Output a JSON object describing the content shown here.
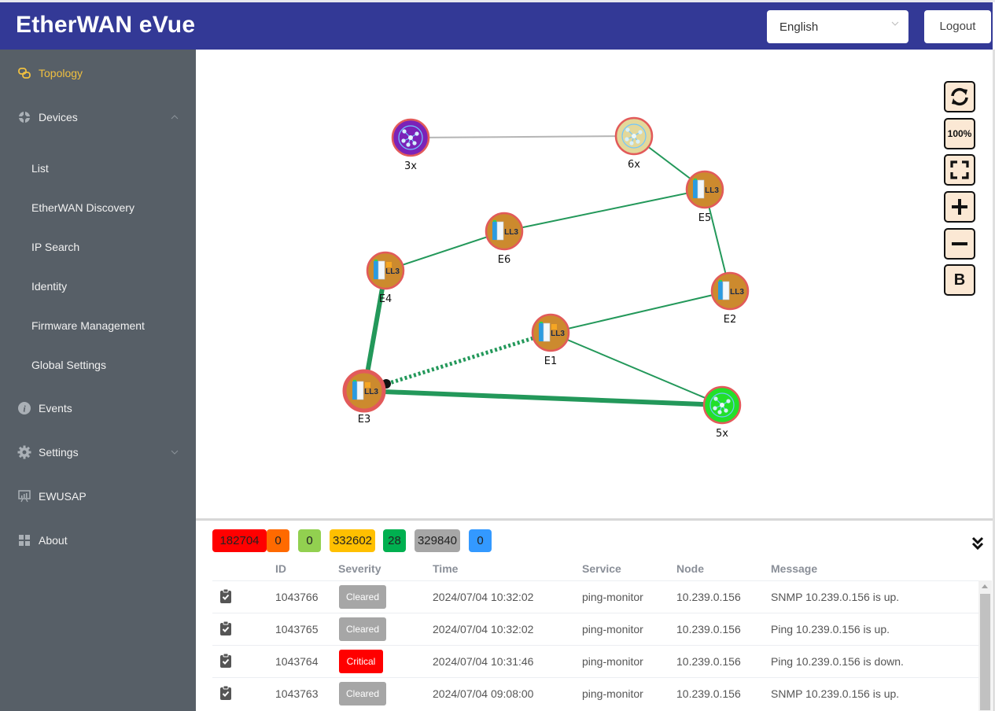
{
  "header": {
    "title": "EtherWAN eVue",
    "language": {
      "selected": "English"
    },
    "logout_label": "Logout"
  },
  "sidebar": {
    "items": [
      {
        "label": "Topology",
        "icon": "topology-icon",
        "active": true
      },
      {
        "label": "Devices",
        "icon": "devices-icon",
        "expanded": true
      },
      {
        "label": "List",
        "sub": true
      },
      {
        "label": "EtherWAN Discovery",
        "sub": true
      },
      {
        "label": "IP Search",
        "sub": true
      },
      {
        "label": "Identity",
        "sub": true
      },
      {
        "label": "Firmware Management",
        "sub": true
      },
      {
        "label": "Global Settings",
        "sub": true
      },
      {
        "label": "Events",
        "icon": "info-icon"
      },
      {
        "label": "Settings",
        "icon": "gear-icon",
        "expanded": false
      },
      {
        "label": "EWUSAP",
        "icon": "presentation-icon"
      },
      {
        "label": "About",
        "icon": "grid-icon"
      }
    ]
  },
  "topology": {
    "toolbar": {
      "refresh": "refresh-icon",
      "zoom_reset_label": "100%",
      "fit": "fullscreen-icon",
      "zoom_in": "plus-icon",
      "zoom_out": "minus-icon",
      "bold_label": "B"
    },
    "nodes": [
      {
        "id": "3x",
        "label": "3x",
        "type": "group",
        "color": "#7b22b8"
      },
      {
        "id": "6x",
        "label": "6x",
        "type": "group",
        "color": "#e3d89a"
      },
      {
        "id": "5x",
        "label": "5x",
        "type": "group",
        "color": "#22e02a"
      },
      {
        "id": "E1",
        "label": "E1",
        "type": "switch",
        "badge": "LL3",
        "alert": true
      },
      {
        "id": "E2",
        "label": "E2",
        "type": "switch",
        "badge": "LL3",
        "alert": false
      },
      {
        "id": "E3",
        "label": "E3",
        "type": "switch",
        "badge": "LL3",
        "alert": true,
        "selected": true
      },
      {
        "id": "E4",
        "label": "E4",
        "type": "switch",
        "badge": "LL3",
        "alert": true
      },
      {
        "id": "E5",
        "label": "E5",
        "type": "switch",
        "badge": "LL3",
        "alert": false
      },
      {
        "id": "E6",
        "label": "E6",
        "type": "switch",
        "badge": "LL3",
        "alert": false
      }
    ],
    "links": [
      {
        "from": "3x",
        "to": "6x",
        "style": "thin-gray"
      },
      {
        "from": "6x",
        "to": "E5",
        "style": "thin-green"
      },
      {
        "from": "E5",
        "to": "E6",
        "style": "thin-green"
      },
      {
        "from": "E5",
        "to": "E2",
        "style": "thin-green"
      },
      {
        "from": "E6",
        "to": "E4",
        "style": "thin-green"
      },
      {
        "from": "E4",
        "to": "E3",
        "style": "thick-green"
      },
      {
        "from": "E2",
        "to": "E1",
        "style": "thin-green"
      },
      {
        "from": "E1",
        "to": "5x",
        "style": "thin-green"
      },
      {
        "from": "E3",
        "to": "E1",
        "style": "dashed-green"
      },
      {
        "from": "E3",
        "to": "5x",
        "style": "thick-green"
      }
    ]
  },
  "events": {
    "counters": [
      {
        "value": "182704",
        "color": "#ff0000"
      },
      {
        "value": "0",
        "color": "#ff6a00"
      },
      {
        "value": "0",
        "color": "#92d050"
      },
      {
        "value": "332602",
        "color": "#ffc000"
      },
      {
        "value": "28",
        "color": "#00b050"
      },
      {
        "value": "329840",
        "color": "#a6a6a6"
      },
      {
        "value": "0",
        "color": "#3399ff"
      }
    ],
    "columns": [
      "ID",
      "Severity",
      "Time",
      "Service",
      "Node",
      "Message"
    ],
    "rows": [
      {
        "id": "1043766",
        "severity": "Cleared",
        "severity_color": "#a6a6a6",
        "time": "2024/07/04 10:32:02",
        "service": "ping-monitor",
        "node": "10.239.0.156",
        "message": "SNMP 10.239.0.156 is up."
      },
      {
        "id": "1043765",
        "severity": "Cleared",
        "severity_color": "#a6a6a6",
        "time": "2024/07/04 10:32:02",
        "service": "ping-monitor",
        "node": "10.239.0.156",
        "message": "Ping 10.239.0.156 is up."
      },
      {
        "id": "1043764",
        "severity": "Critical",
        "severity_color": "#ff0000",
        "time": "2024/07/04 10:31:46",
        "service": "ping-monitor",
        "node": "10.239.0.156",
        "message": "Ping 10.239.0.156 is down."
      },
      {
        "id": "1043763",
        "severity": "Cleared",
        "severity_color": "#a6a6a6",
        "time": "2024/07/04 09:08:00",
        "service": "ping-monitor",
        "node": "10.239.0.156",
        "message": "SNMP 10.239.0.156 is up."
      }
    ]
  }
}
